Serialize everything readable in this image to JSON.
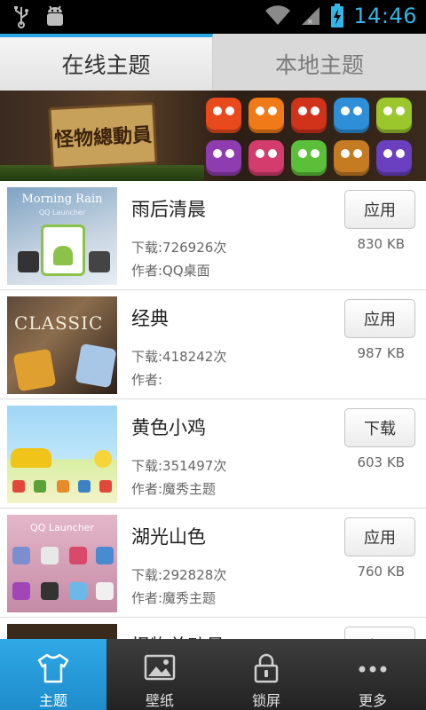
{
  "status_bar": {
    "time": "14:46",
    "time_color": "#33b5e5",
    "icons": [
      "usb-icon",
      "android-debug-icon",
      "wifi-icon",
      "signal-icon",
      "battery-charging-icon"
    ]
  },
  "tabs": [
    {
      "label": "在线主题",
      "active": true
    },
    {
      "label": "本地主题",
      "active": false
    }
  ],
  "banner": {
    "sign_text": "怪物總動員",
    "monster_colors": [
      "#e84a1e",
      "#f07a18",
      "#d0321a",
      "#2e8fd8",
      "#9bc62c",
      "#8e3db0",
      "#d43c6e",
      "#5cbf3a",
      "#c57b22",
      "#6a3fc0"
    ]
  },
  "themes": [
    {
      "title": "雨后清晨",
      "downloads": "下载:726926次",
      "author": "作者:QQ桌面",
      "button": "应用",
      "size": "830 KB",
      "thumb_caption": "Morning Rain",
      "thumb_sub": "QQ Launcher"
    },
    {
      "title": "经典",
      "downloads": "下载:418242次",
      "author": "作者:",
      "button": "应用",
      "size": "987 KB",
      "thumb_caption": "CLASSIC"
    },
    {
      "title": "黄色小鸡",
      "downloads": "下载:351497次",
      "author": "作者:魔秀主题",
      "button": "下载",
      "size": "603 KB"
    },
    {
      "title": "湖光山色",
      "downloads": "下载:292828次",
      "author": "作者:魔秀主题",
      "button": "应用",
      "size": "760 KB",
      "thumb_caption": "QQ Launcher"
    },
    {
      "title": "怪物总动员",
      "button": "应用"
    }
  ],
  "bottom_nav": [
    {
      "label": "主题",
      "icon": "tshirt-icon",
      "active": true
    },
    {
      "label": "壁纸",
      "icon": "picture-icon",
      "active": false
    },
    {
      "label": "锁屏",
      "icon": "lock-icon",
      "active": false
    },
    {
      "label": "更多",
      "icon": "more-icon",
      "active": false
    }
  ],
  "colors": {
    "accent": "#2ea6e3",
    "nav_bg": "#2e2e2e"
  }
}
